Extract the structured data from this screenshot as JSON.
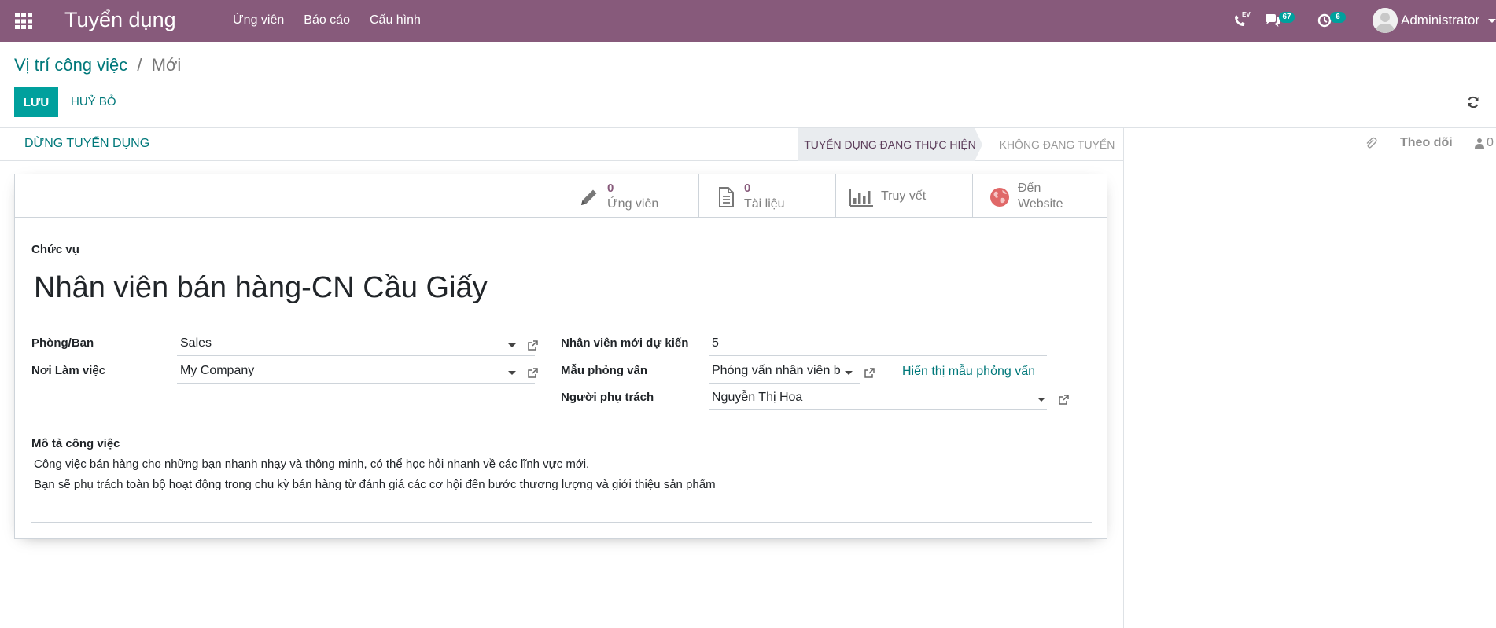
{
  "topnav": {
    "app_title": "Tuyển dụng",
    "menu": [
      "Ứng viên",
      "Báo cáo",
      "Cấu hình"
    ],
    "messages_badge": "67",
    "activities_badge": "6",
    "voip_label": "EV",
    "user_name": "Administrator",
    "colors": {
      "bar": "#875a7b",
      "badge": "#00a09d"
    }
  },
  "breadcrumb": {
    "parent": "Vị trí công việc",
    "separator": "/",
    "current": "Mới"
  },
  "buttons": {
    "save": "LƯU",
    "discard": "HUỶ BỎ",
    "stop": "DỪNG TUYỂN DỤNG"
  },
  "statusbar": {
    "current_stage": "TUYỂN DỤNG ĐANG THỰC HIỆN",
    "other_stage": "KHÔNG ĐANG TUYỂN"
  },
  "chatter": {
    "follow": "Theo dõi",
    "followers_count": "0"
  },
  "smart_buttons": {
    "applicants": {
      "value": "0",
      "label": "Ứng viên"
    },
    "documents": {
      "value": "0",
      "label": "Tài liệu"
    },
    "tracking": {
      "label": "Truy vết"
    },
    "website": {
      "label_1": "Đến",
      "label_2": "Website"
    }
  },
  "form": {
    "title_label": "Chức vụ",
    "title_value": "Nhân viên bán hàng-CN Cầu Giấy",
    "department_label": "Phòng/Ban",
    "department_value": "Sales",
    "workplace_label": "Nơi Làm việc",
    "workplace_value": "My Company",
    "expected_label": "Nhân viên mới dự kiến",
    "expected_value": "5",
    "survey_label": "Mẫu phỏng vấn",
    "survey_value": "Phỏng vấn nhân viên b",
    "survey_link": "Hiển thị mẫu phỏng vấn",
    "responsible_label": "Người phụ trách",
    "responsible_value": "Nguyễn Thị Hoa",
    "description_label": "Mô tả công việc",
    "description_lines": [
      "Công việc bán hàng cho những bạn nhanh nhạy và thông minh, có thể học hỏi nhanh về các lĩnh vực mới.",
      "Bạn sẽ phụ trách toàn bộ hoạt động trong chu kỳ bán hàng từ đánh giá các cơ hội đến bước thương lượng và giới thiệu sản phẩm"
    ]
  }
}
